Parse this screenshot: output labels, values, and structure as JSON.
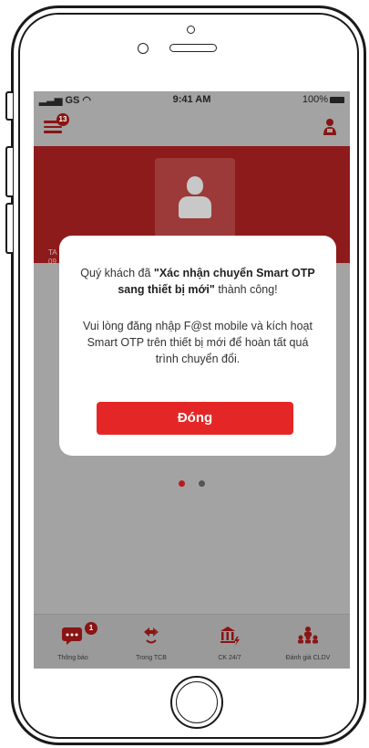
{
  "statusbar": {
    "carrier": "GS",
    "time": "9:41 AM",
    "battery": "100%"
  },
  "appbar": {
    "notification_count": "13"
  },
  "banner": {
    "text": "TA\n09"
  },
  "dialog": {
    "line1_prefix": "Quý khách đã ",
    "line1_bold": "\"Xác nhận chuyển Smart OTP sang thiết bị mới\"",
    "line1_suffix": " thành công!",
    "line2": "Vui lòng đăng nhập F@st mobile và kích hoạt Smart OTP trên thiết bị mới để hoàn tất quá trình chuyển đổi.",
    "button_label": "Đóng"
  },
  "pager": {
    "active_color": "#b71c1c",
    "inactive_color": "#555555"
  },
  "bottom_nav": {
    "items": [
      {
        "label": "Thông báo",
        "icon": "chat-bubble-icon",
        "badge": "1"
      },
      {
        "label": "Trong TCB",
        "icon": "transfer-arrows-icon"
      },
      {
        "label": "CK 24/7",
        "icon": "bank-lightning-icon"
      },
      {
        "label": "Đánh giá CLDV",
        "icon": "rating-people-icon"
      }
    ]
  },
  "colors": {
    "accent": "#e42726",
    "brand_dark": "#8a1414",
    "overlay": "#a3a3a3"
  }
}
